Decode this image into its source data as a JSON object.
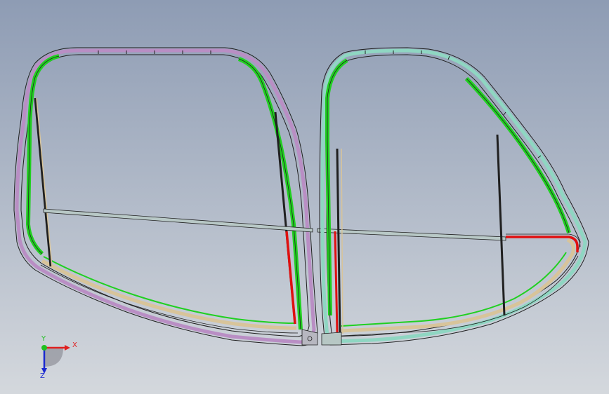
{
  "viewport": {
    "background_top": "#8e9cb4",
    "background_bottom": "#d4d8dd"
  },
  "triad": {
    "x_label": "X",
    "y_label": "Y",
    "z_label": "Z",
    "x_color": "#e02020",
    "y_color": "#20c020",
    "z_color": "#1a28d0"
  },
  "colors": {
    "left_frame": "#b98ec4",
    "right_frame": "#8fd6c2",
    "seal": "#20d020",
    "red_part": "#e01010",
    "crossbar": "#b8c8c6",
    "dark_edge": "#202020",
    "tan": "#d8c49a"
  }
}
